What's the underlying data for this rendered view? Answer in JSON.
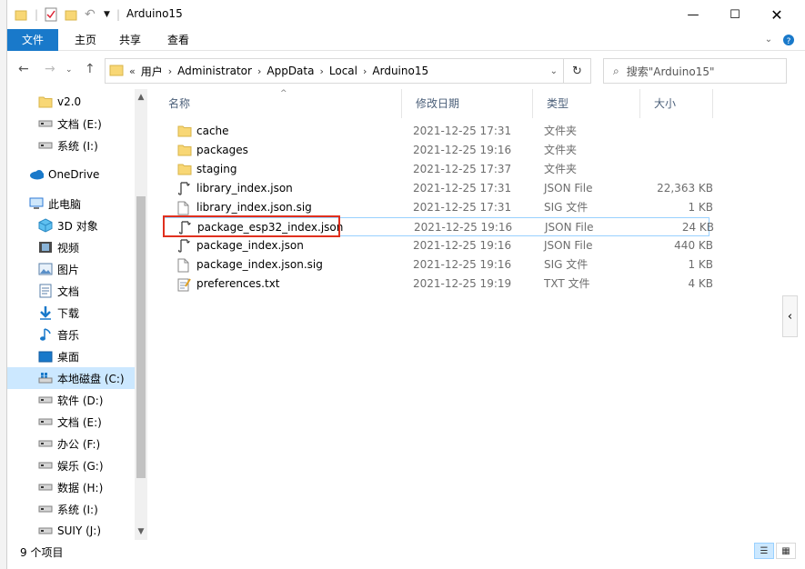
{
  "window": {
    "title": "Arduino15"
  },
  "ribbon": {
    "tabs": [
      "文件",
      "主页",
      "共享",
      "查看"
    ]
  },
  "address": {
    "overflow": "«",
    "crumbs": [
      "用户",
      "Administrator",
      "AppData",
      "Local",
      "Arduino15"
    ]
  },
  "search": {
    "placeholder": "搜索\"Arduino15\""
  },
  "sidebar": {
    "items": [
      {
        "label": "v2.0",
        "icon": "folder-icon"
      },
      {
        "label": "文档 (E:)",
        "icon": "drive-icon"
      },
      {
        "label": "系统 (I:)",
        "icon": "drive-icon"
      },
      {
        "label": "OneDrive",
        "icon": "cloud-icon"
      },
      {
        "label": "此电脑",
        "icon": "computer-icon"
      },
      {
        "label": "3D 对象",
        "icon": "cube-icon"
      },
      {
        "label": "视频",
        "icon": "video-icon"
      },
      {
        "label": "图片",
        "icon": "picture-icon"
      },
      {
        "label": "文档",
        "icon": "document-icon"
      },
      {
        "label": "下载",
        "icon": "download-icon"
      },
      {
        "label": "音乐",
        "icon": "music-icon"
      },
      {
        "label": "桌面",
        "icon": "desktop-icon"
      },
      {
        "label": "本地磁盘 (C:)",
        "icon": "windows-drive-icon"
      },
      {
        "label": "软件 (D:)",
        "icon": "drive-icon"
      },
      {
        "label": "文档 (E:)",
        "icon": "drive-icon"
      },
      {
        "label": "办公 (F:)",
        "icon": "drive-icon"
      },
      {
        "label": "娱乐 (G:)",
        "icon": "drive-icon"
      },
      {
        "label": "数据 (H:)",
        "icon": "drive-icon"
      },
      {
        "label": "系统 (I:)",
        "icon": "drive-icon"
      },
      {
        "label": "SUIY (J:)",
        "icon": "drive-icon"
      }
    ],
    "selected_index": 12
  },
  "columns": {
    "name": "名称",
    "date": "修改日期",
    "type": "类型",
    "size": "大小"
  },
  "files": [
    {
      "name": "cache",
      "date": "2021-12-25 17:31",
      "type": "文件夹",
      "size": "",
      "icon": "folder-icon"
    },
    {
      "name": "packages",
      "date": "2021-12-25 19:16",
      "type": "文件夹",
      "size": "",
      "icon": "folder-icon"
    },
    {
      "name": "staging",
      "date": "2021-12-25 17:37",
      "type": "文件夹",
      "size": "",
      "icon": "folder-icon"
    },
    {
      "name": "library_index.json",
      "date": "2021-12-25 17:31",
      "type": "JSON File",
      "size": "22,363 KB",
      "icon": "json-file-icon"
    },
    {
      "name": "library_index.json.sig",
      "date": "2021-12-25 17:31",
      "type": "SIG 文件",
      "size": "1 KB",
      "icon": "blank-file-icon"
    },
    {
      "name": "package_esp32_index.json",
      "date": "2021-12-25 19:16",
      "type": "JSON File",
      "size": "24 KB",
      "icon": "json-file-icon"
    },
    {
      "name": "package_index.json",
      "date": "2021-12-25 19:16",
      "type": "JSON File",
      "size": "440 KB",
      "icon": "json-file-icon"
    },
    {
      "name": "package_index.json.sig",
      "date": "2021-12-25 19:16",
      "type": "SIG 文件",
      "size": "1 KB",
      "icon": "blank-file-icon"
    },
    {
      "name": "preferences.txt",
      "date": "2021-12-25 19:19",
      "type": "TXT 文件",
      "size": "4 KB",
      "icon": "text-file-icon"
    }
  ],
  "highlighted_row": 5,
  "status": {
    "count": "9 个项目"
  },
  "colors": {
    "accent": "#1979ca",
    "selection": "#cce8ff",
    "highlight_box": "#e0301e",
    "folder": "#f8d775"
  }
}
